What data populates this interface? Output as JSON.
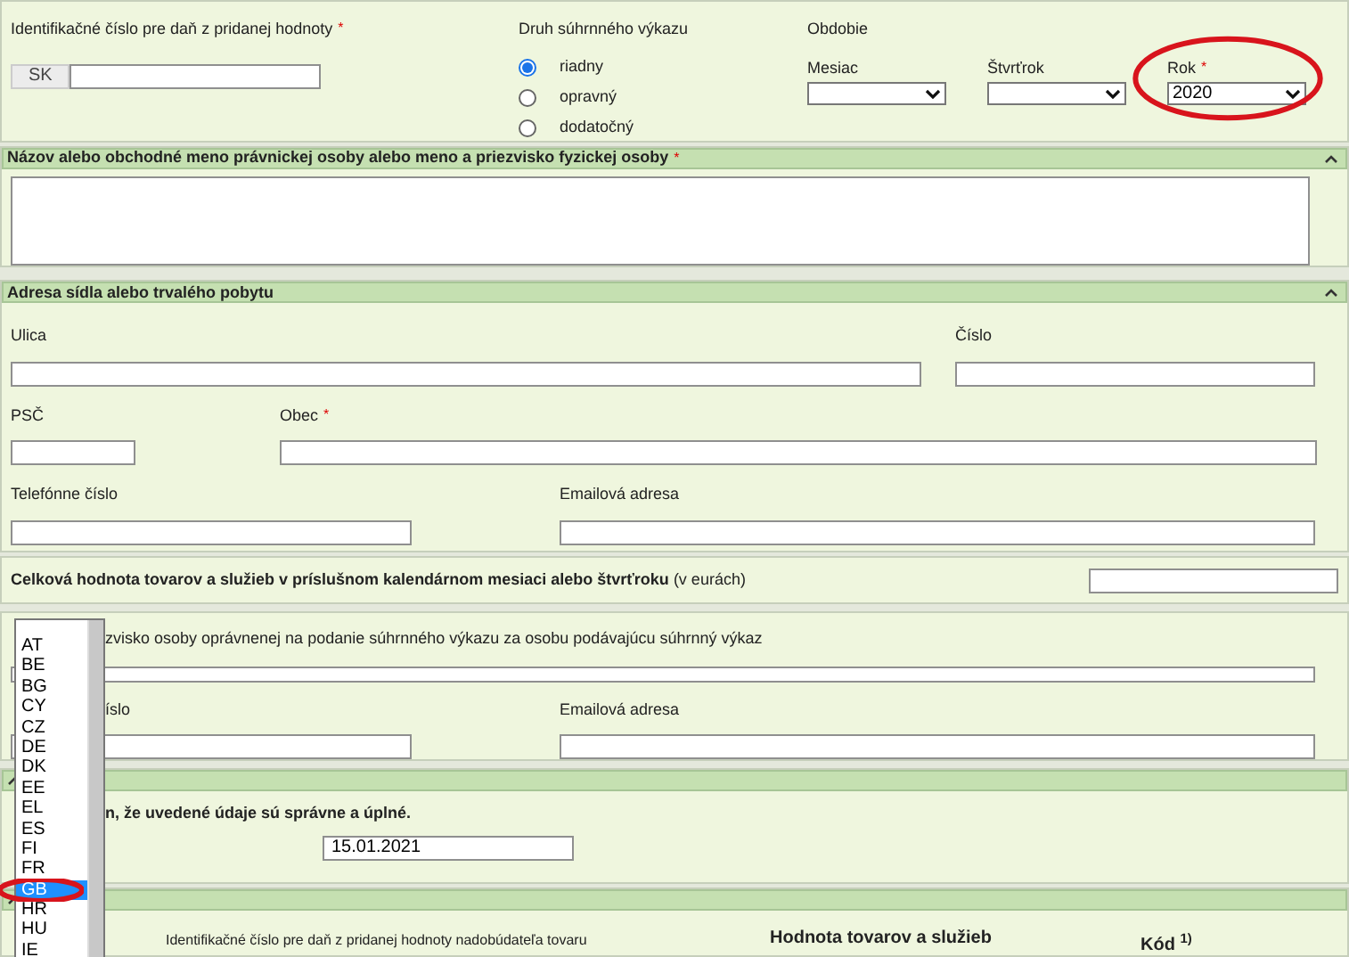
{
  "vat_id": {
    "label": "Identifikačné číslo pre daň z pridanej hodnoty",
    "required_mark": "*",
    "prefix": "SK"
  },
  "report_type": {
    "label": "Druh súhrnného výkazu",
    "options": [
      {
        "label": "riadny",
        "selected": true
      },
      {
        "label": "opravný",
        "selected": false
      },
      {
        "label": "dodatočný",
        "selected": false
      }
    ]
  },
  "period": {
    "label": "Obdobie",
    "fields": [
      {
        "label": "Mesiac",
        "highlighted": false
      },
      {
        "label": "Štvrťrok",
        "highlighted": false
      },
      {
        "label": "Rok",
        "required_mark": "*",
        "value": "2020",
        "highlighted": true
      }
    ]
  },
  "name_section": {
    "title": "Názov alebo obchodné meno právnickej osoby alebo meno a priezvisko fyzickej osoby",
    "required_mark": "*"
  },
  "address_section": {
    "title": "Adresa sídla alebo trvalého pobytu",
    "fields": [
      {
        "label": "Ulica"
      },
      {
        "label": "Číslo"
      },
      {
        "label": "PSČ"
      },
      {
        "label": "Obec",
        "required_mark": "*"
      },
      {
        "label": "Telefónne číslo"
      },
      {
        "label": "Emailová adresa"
      }
    ]
  },
  "total_value": {
    "label": "Celková hodnota tovarov a služieb v príslušnom kalendárnom mesiaci alebo štvrťroku",
    "unit": "(v eurách)"
  },
  "authorized_person": {
    "label_parts": [
      "zvisko osoby oprávnenej na podanie súhrnného výkazu za osobu podávajúcu súhrnný výkaz"
    ],
    "phone_label": "íslo",
    "email_label": "Emailová adresa"
  },
  "declaration_section": {
    "text": "n, že uvedené údaje sú správne a úplné.",
    "date": "15.01.2021"
  },
  "items_section": {
    "columns": [
      "Identifikačné číslo pre daň z pridanej hodnoty nadobúdateľa tovaru",
      "Hodnota tovarov a služieb",
      "Kód $^{1)}$"
    ]
  },
  "country_dropdown": {
    "options": [
      {
        "label": "AT",
        "selected": false,
        "highlighted": false
      },
      {
        "label": "BE",
        "selected": false,
        "highlighted": false
      },
      {
        "label": "BG",
        "selected": false,
        "highlighted": false
      },
      {
        "label": "CY",
        "selected": false,
        "highlighted": false
      },
      {
        "label": "CZ",
        "selected": false,
        "highlighted": false
      },
      {
        "label": "DE",
        "selected": false,
        "highlighted": false
      },
      {
        "label": "DK",
        "selected": false,
        "highlighted": false
      },
      {
        "label": "EE",
        "selected": false,
        "highlighted": false
      },
      {
        "label": "EL",
        "selected": false,
        "highlighted": false
      },
      {
        "label": "ES",
        "selected": false,
        "highlighted": false
      },
      {
        "label": "FI",
        "selected": false,
        "highlighted": false
      },
      {
        "label": "FR",
        "selected": false,
        "highlighted": false
      },
      {
        "label": "GB",
        "selected": true,
        "highlighted": true
      },
      {
        "label": "HR",
        "selected": false,
        "highlighted": false
      },
      {
        "label": "HU",
        "selected": false,
        "highlighted": false
      },
      {
        "label": "IE",
        "selected": false,
        "highlighted": false
      }
    ]
  }
}
